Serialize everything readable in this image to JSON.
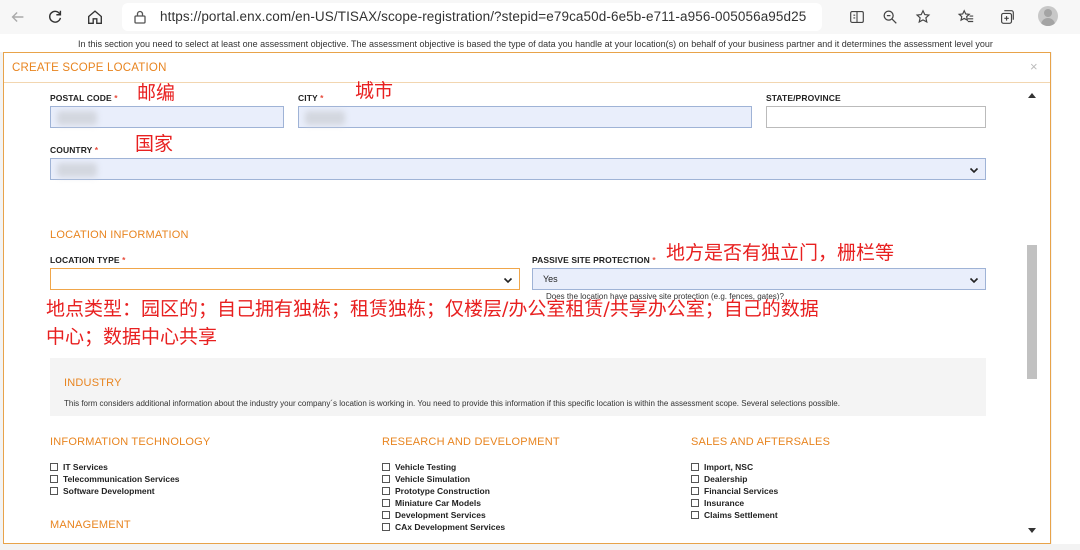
{
  "browser": {
    "url": "https://portal.enx.com/en-US/TISAX/scope-registration/?stepid=e79ca50d-6e5b-e711-a956-005056a95d25"
  },
  "background": {
    "intro": "In this section you need to select at least one assessment objective. The assessment objective is based the type of data you handle at your location(s) on behalf of your business partner and it determines the assessment level your"
  },
  "modal": {
    "title": "CREATE SCOPE LOCATION",
    "close": "×"
  },
  "address": {
    "postal_code_label": "POSTAL CODE",
    "city_label": "CITY",
    "state_label": "STATE/PROVINCE",
    "country_label": "COUNTRY",
    "required_mark": "*"
  },
  "location_info": {
    "section_title": "LOCATION INFORMATION",
    "location_type_label": "LOCATION TYPE",
    "location_type_value": "",
    "passive_label": "PASSIVE SITE PROTECTION",
    "passive_value": "Yes",
    "passive_help": "Does the location have passive site protection (e.g. fences, gates)?"
  },
  "industry": {
    "title": "INDUSTRY",
    "description": "This form considers additional information about the industry your company´s location is working in. You need to provide this information if this specific location is within the assessment scope. Several selections possible."
  },
  "categories": [
    {
      "title": "INFORMATION TECHNOLOGY",
      "items": [
        "IT Services",
        "Telecommunication Services",
        "Software Development"
      ]
    },
    {
      "title": "RESEARCH AND DEVELOPMENT",
      "items": [
        "Vehicle Testing",
        "Vehicle Simulation",
        "Prototype Construction",
        "Miniature Car Models",
        "Development Services",
        "CAx Development Services"
      ]
    },
    {
      "title": "SALES AND AFTERSALES",
      "items": [
        "Import, NSC",
        "Dealership",
        "Financial Services",
        "Insurance",
        "Claims Settlement"
      ]
    },
    {
      "title": "MANAGEMENT",
      "items": []
    }
  ],
  "annotations": {
    "postal": "邮编",
    "city": "城市",
    "country": "国家",
    "passive": "地方是否有独立门，栅栏等",
    "location_type_line1": "地点类型：园区的；自己拥有独栋；租赁独栋；仅楼层/办公室租赁/共享办公室；自己的数据",
    "location_type_line2": "中心；数据中心共享"
  },
  "colors": {
    "accent": "#e8841f",
    "annotation": "#e82020",
    "field_fill": "#e9eefb"
  }
}
